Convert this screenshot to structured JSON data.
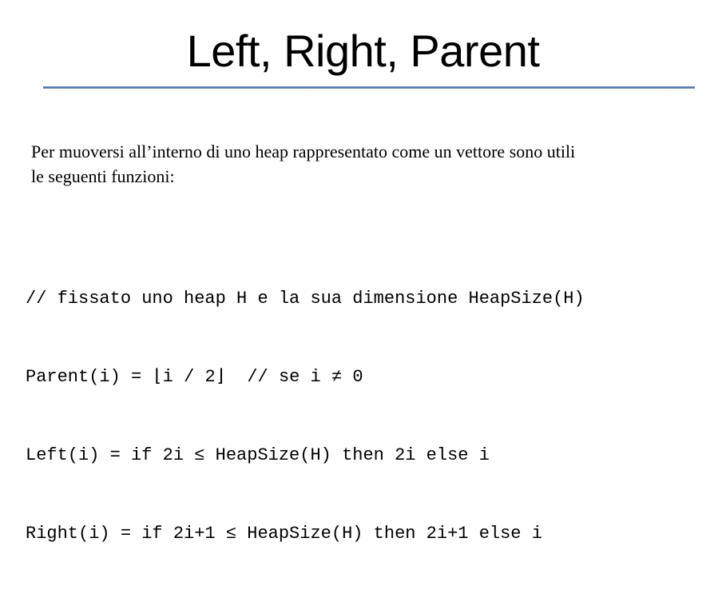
{
  "slide": {
    "title": "Left, Right, Parent",
    "intro_line_1": "Per muoversi all’interno di uno heap rappresentato come un vettore sono utili",
    "intro_line_2": "le seguenti funzioni:",
    "accent_color": "#4f74ad",
    "code_lines": [
      "// fissato uno heap H e la sua dimensione HeapSize(H)",
      "Parent(i) = ⌊i / 2⌋  // se i ≠ 0",
      "Left(i) = if 2i ≤ HeapSize(H) then 2i else i",
      "Right(i) = if 2i+1 ≤ HeapSize(H) then 2i+1 else i"
    ]
  }
}
